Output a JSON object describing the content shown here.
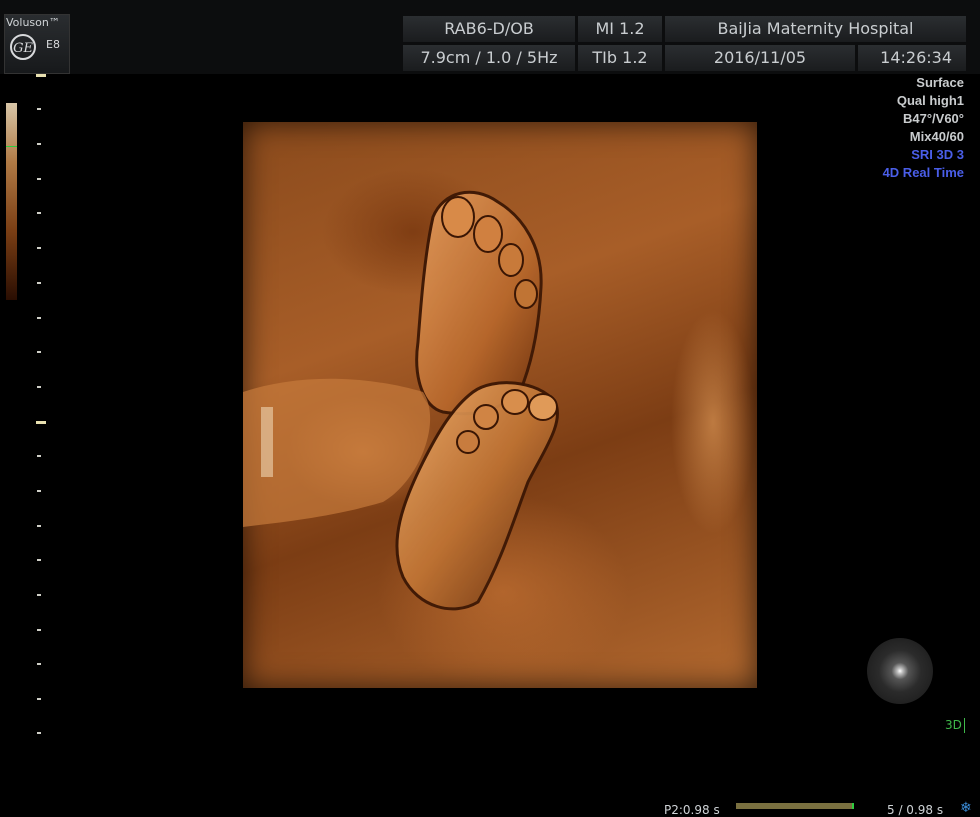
{
  "brand": {
    "name": "Voluson™",
    "model": "E8",
    "logo_text": "GE"
  },
  "header": {
    "probe": "RAB6-D/OB",
    "mi": "MI  1.2",
    "hospital": "BaiJia Maternity Hospital",
    "scan_params": "7.9cm / 1.0 /  5Hz",
    "tib": "TIb  1.2",
    "date": "2016/11/05",
    "time": "14:26:34"
  },
  "render_info": {
    "surface": "Surface",
    "quality": "Qual high1",
    "angles": "B47°/V60°",
    "mix": "Mix40/60",
    "sri": "SRI 3D 3",
    "mode": "4D Real Time"
  },
  "mode_indicator": "3D",
  "bottom": {
    "left_text": "P2:0.98 s",
    "right_text": "5 / 0.98 s"
  },
  "colors": {
    "tint": "#a85e28",
    "info_blue": "#4a5ee8",
    "accent_green": "#3fb94a"
  },
  "icons": {
    "logo": "ge-logo-icon",
    "orientation": "orientation-ball-icon",
    "freeze": "snowflake-icon"
  }
}
